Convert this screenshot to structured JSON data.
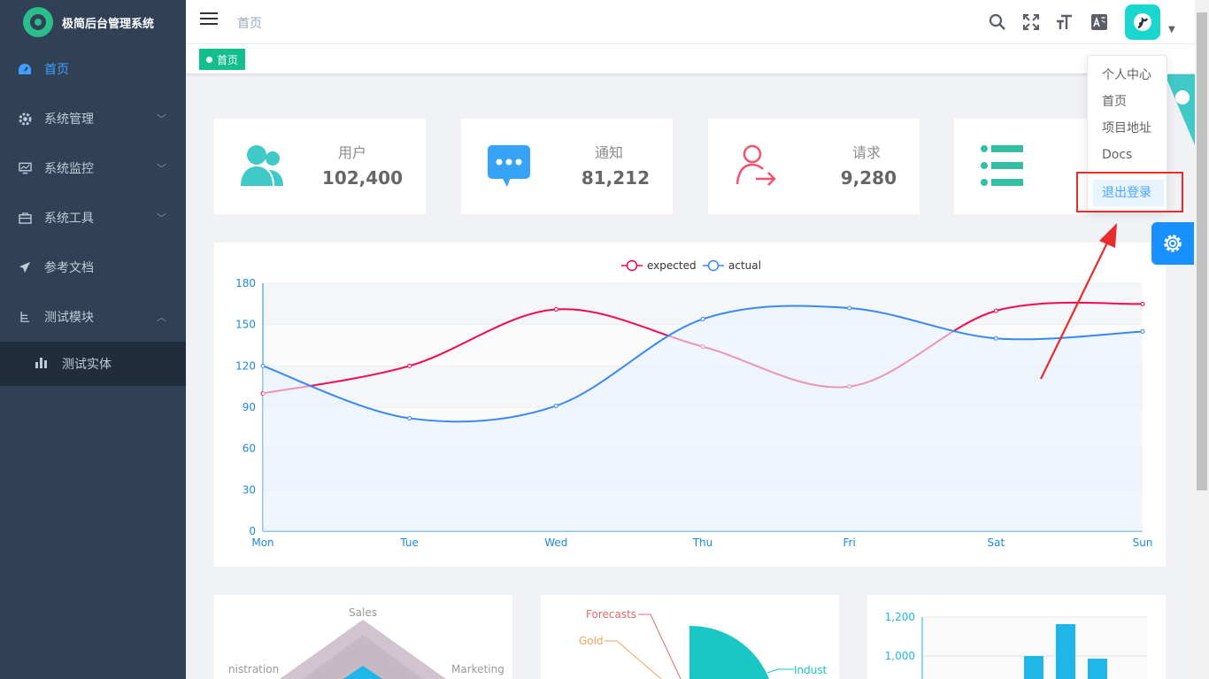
{
  "app": {
    "title": "极简后台管理系统"
  },
  "sidebar": {
    "items": [
      {
        "label": "首页"
      },
      {
        "label": "系统管理"
      },
      {
        "label": "系统监控"
      },
      {
        "label": "系统工具"
      },
      {
        "label": "参考文档"
      },
      {
        "label": "测试模块"
      }
    ],
    "sub_items": [
      {
        "label": "测试实体"
      }
    ]
  },
  "navbar": {
    "breadcrumb": "首页"
  },
  "tags": {
    "active": "首页"
  },
  "cards": [
    {
      "label": "用户",
      "value": "102,400",
      "color": "#40c9c6"
    },
    {
      "label": "通知",
      "value": "81,212",
      "color": "#36a3f7"
    },
    {
      "label": "请求",
      "value": "9,280",
      "color": "#f4516c"
    },
    {
      "label": "",
      "value": "",
      "color": "#34bfa3"
    }
  ],
  "dropdown": {
    "items": [
      "个人中心",
      "首页",
      "项目地址",
      "Docs"
    ],
    "logout": "退出登录"
  },
  "chart_data": {
    "type": "line",
    "categories": [
      "Mon",
      "Tue",
      "Wed",
      "Thu",
      "Fri",
      "Sat",
      "Sun"
    ],
    "series": [
      {
        "name": "expected",
        "values": [
          100,
          120,
          161,
          134,
          105,
          160,
          165
        ],
        "color": "#f2084e"
      },
      {
        "name": "actual",
        "values": [
          120,
          82,
          91,
          154,
          162,
          140,
          145
        ],
        "color": "#3888fa"
      }
    ],
    "ylim": [
      0,
      180
    ],
    "yticks": [
      0,
      30,
      60,
      90,
      120,
      150,
      180
    ],
    "legend": "top-center",
    "grid": true
  },
  "bottom_charts": {
    "radar_labels": [
      "Sales",
      "nistration",
      "Marketing"
    ],
    "pie_labels": [
      "Forecasts",
      "Gold",
      "Indust"
    ],
    "bar_yticks": [
      "1,200",
      "1,000"
    ]
  }
}
